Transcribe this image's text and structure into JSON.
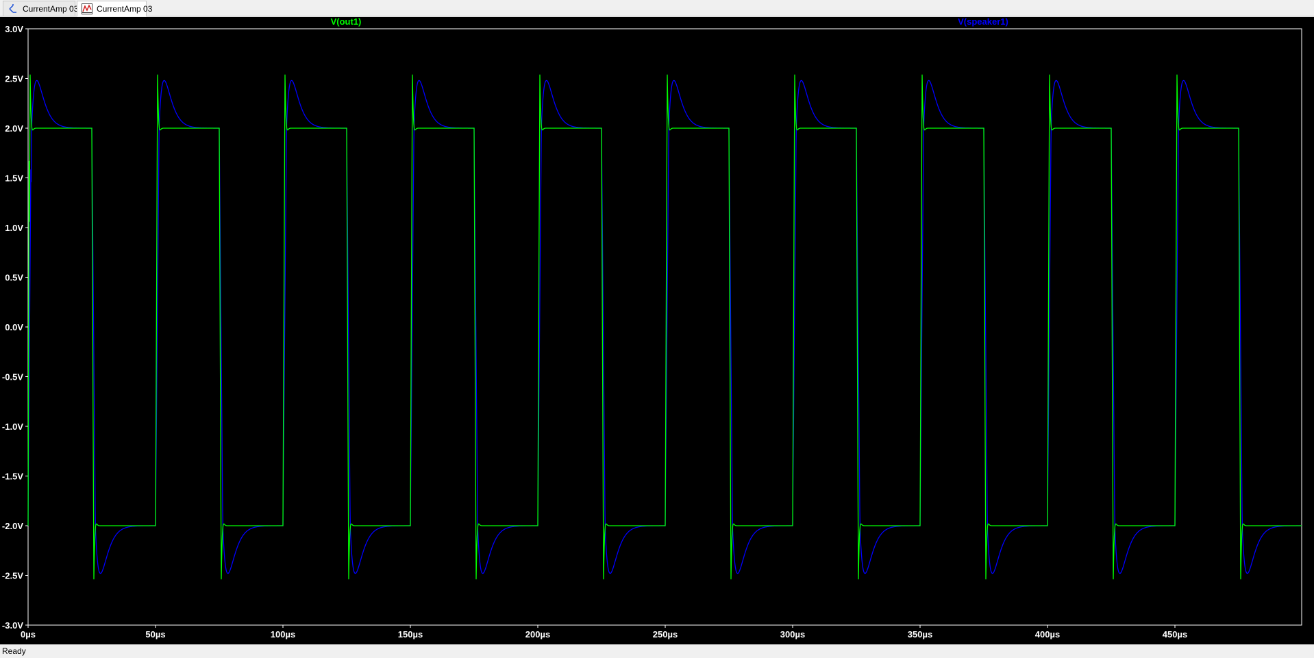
{
  "tabs": [
    {
      "label": "CurrentAmp 03",
      "icon": "schematic-icon"
    },
    {
      "label": "CurrentAmp 03",
      "icon": "waveform-icon"
    }
  ],
  "status": {
    "text": "Ready"
  },
  "colors": {
    "background": "#000000",
    "axis": "#ffffff",
    "out1": "#00ff00",
    "speaker1": "#0000ff"
  },
  "chart_data": {
    "type": "line",
    "title": "",
    "xlabel": "",
    "ylabel": "",
    "xlim": [
      0,
      500
    ],
    "ylim": [
      -3.0,
      3.0
    ],
    "x_unit": "µs",
    "y_unit": "V",
    "x_ticks": [
      "0µs",
      "50µs",
      "100µs",
      "150µs",
      "200µs",
      "250µs",
      "300µs",
      "350µs",
      "400µs",
      "450µs"
    ],
    "y_ticks": [
      "3.0V",
      "2.5V",
      "2.0V",
      "1.5V",
      "1.0V",
      "0.5V",
      "0.0V",
      "-0.5V",
      "-1.0V",
      "-1.5V",
      "-2.0V",
      "-2.5V",
      "-3.0V"
    ],
    "series": [
      {
        "name": "V(out1)",
        "period_us": 50,
        "high": 2.0,
        "low": -2.0,
        "overshoot_peak": 2.55,
        "undershoot_peak": -2.55,
        "color": "#00ff00"
      },
      {
        "name": "V(speaker1)",
        "period_us": 50,
        "high": 2.0,
        "low": -2.0,
        "overshoot_peak": 2.48,
        "undershoot_peak": -2.48,
        "color": "#0000ff"
      }
    ]
  }
}
